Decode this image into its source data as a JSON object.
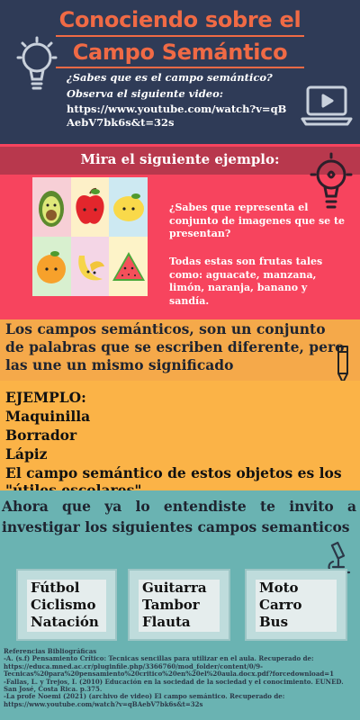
{
  "header": {
    "title_line1": "Conociendo sobre el",
    "title_line2": "Campo Semántico",
    "question1": "¿Sabes que es el campo semántico?",
    "question2": "Observa el siguiente video:",
    "video_url": "https://www.youtube.com/watch?v=qBAebV7bk6s&t=32s"
  },
  "example": {
    "heading": "Mira el siguiente ejemplo:",
    "paragraph1": "¿Sabes que representa el conjunto de imagenes que se te presentan?",
    "paragraph2": "Todas estas son frutas tales como: aguacate, manzana, limón, naranja, banano y sandía.",
    "images": [
      "avocado",
      "apple",
      "lemon",
      "orange",
      "banana",
      "watermelon"
    ]
  },
  "definition": {
    "text": "Los campos semánticos, son un conjunto de palabras que se escriben diferente, pero las une un mismo significado"
  },
  "ejemplo": {
    "label": "EJEMPLO:",
    "items": [
      "Maquinilla",
      "Borrador",
      "Lápiz"
    ],
    "conclusion": "El campo semántico de estos objetos es los \"útiles escolares\""
  },
  "invite": {
    "text": "Ahora que ya lo entendiste te invito a investigar los siguientes campos semanticos",
    "groups": [
      [
        "Fútbol",
        "Ciclismo",
        "Natación"
      ],
      [
        "Guitarra",
        "Tambor",
        "Flauta"
      ],
      [
        "Moto",
        "Carro",
        "Bus"
      ]
    ]
  },
  "references": {
    "heading": "Referencias Bibliográficas",
    "entries": [
      "-A. (s.f) Pensamiento Crítico: Tecnicas sencillas para utilizar en el aula. Recuperado de: https://educa.mned.ac.cr/pluginfile.php/3366760/mod_folder/content/0/9-Tecnicas%20para%20pensamiento%20critico%20en%20el%20aula.docx.pdf?forcedownload=1",
      "-Fallas, L. y Trejos, I. (2010) Educación en la sociedad de la sociedad y el conocimiento. EUNED. San José, Costa Rica. p.375.",
      "-La profe Noemi (2021) (archivo de video) El campo semántico. Recuperado de: https://www.youtube.com/watch?v=qBAebV7bk6s&t=32s"
    ]
  },
  "colors": {
    "navy": "#2f3b57",
    "coral": "#f06a45",
    "pink": "#f7445e",
    "dark_pink": "#b8384d",
    "orange": "#f5a94a",
    "yellow": "#fbb347",
    "teal": "#6ab3b2"
  }
}
